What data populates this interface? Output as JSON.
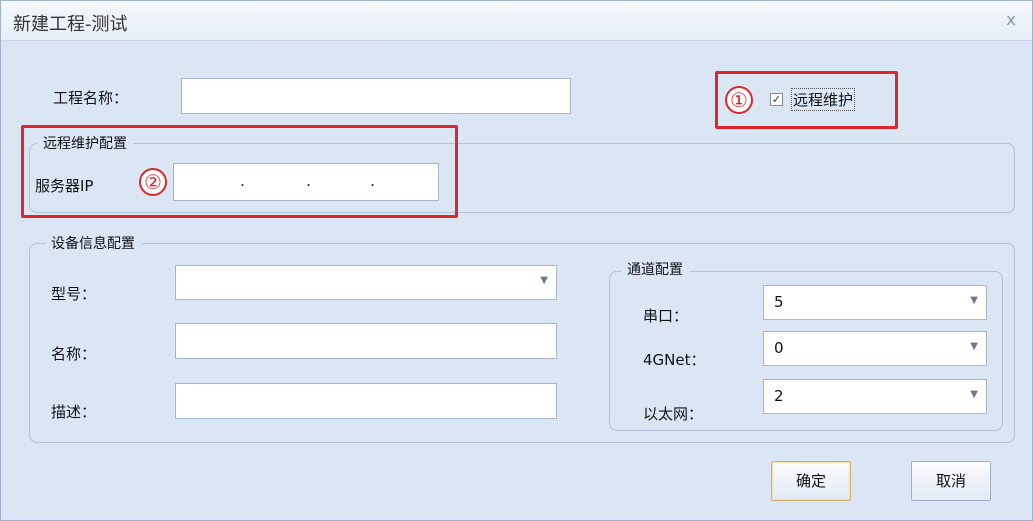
{
  "window": {
    "title": "新建工程-测试",
    "close_glyph": "x"
  },
  "project": {
    "name_label": "工程名称：",
    "name_value": "",
    "remote_label": "远程维护",
    "remote_checked": true,
    "annotation_1": "①"
  },
  "remote_config": {
    "legend": "远程维护配置",
    "server_ip_label": "服务器IP",
    "annotation_2": "②",
    "ip_separators": [
      ".",
      ".",
      "."
    ]
  },
  "device_config": {
    "legend": "设备信息配置",
    "model_label": "型号：",
    "model_value": "",
    "name_label": "名称：",
    "name_value": "",
    "desc_label": "描述：",
    "desc_value": ""
  },
  "channel_config": {
    "legend": "通道配置",
    "serial_label": "串口：",
    "serial_value": "5",
    "net4g_label": "4GNet：",
    "net4g_value": "0",
    "ethernet_label": "以太网：",
    "ethernet_value": "2"
  },
  "buttons": {
    "ok": "确定",
    "cancel": "取消"
  },
  "icons": {
    "dropdown": "chevron-down-icon",
    "close": "close-icon",
    "check": "check-icon"
  },
  "colors": {
    "annotation_red": "#e0262a",
    "dialog_bg": "#dbe6f5"
  }
}
